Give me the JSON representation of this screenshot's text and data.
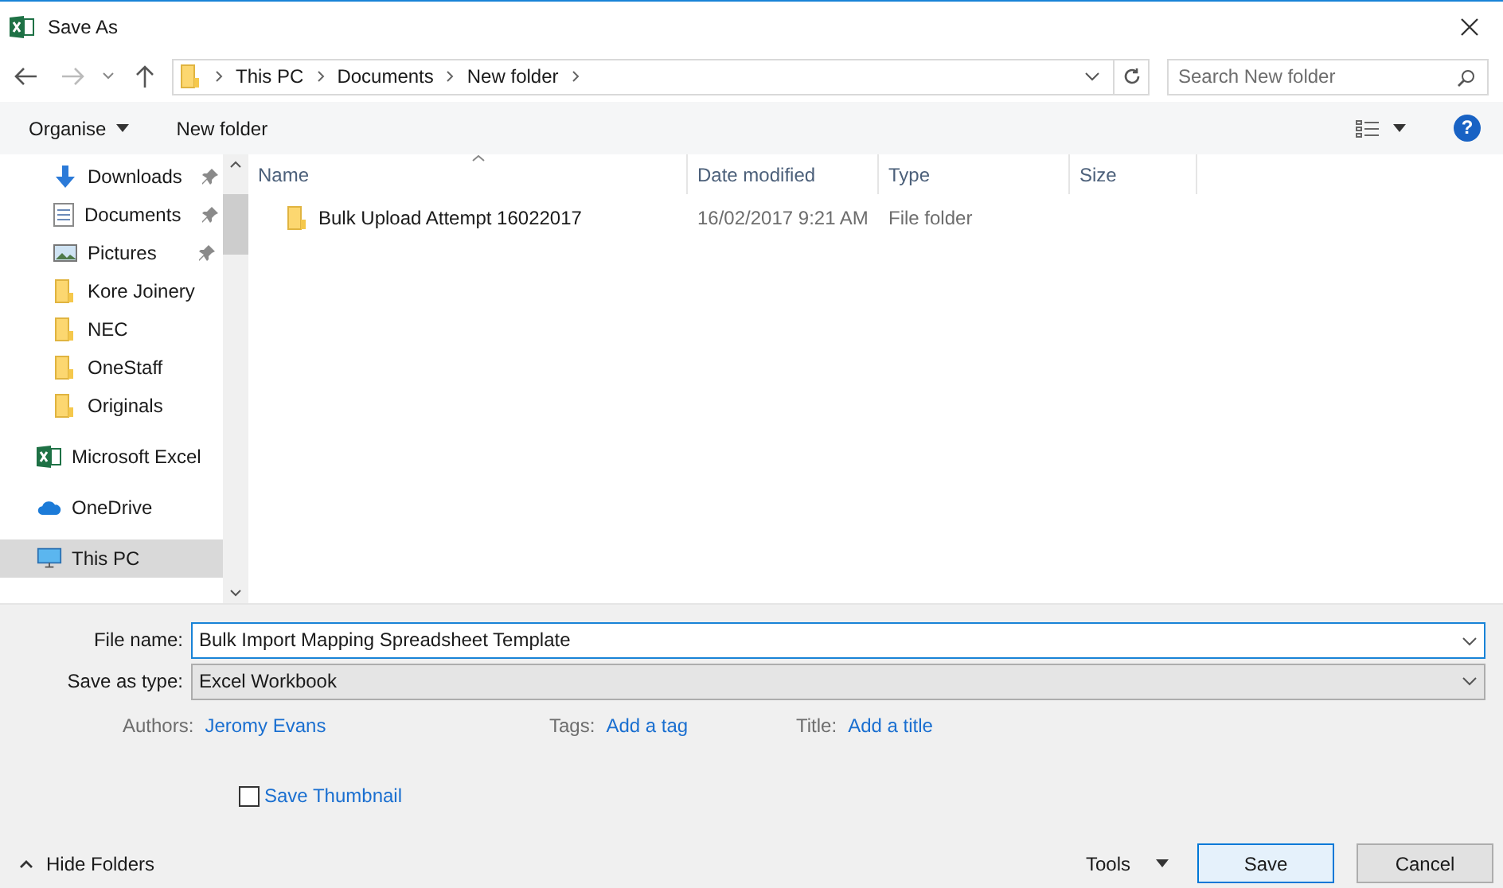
{
  "window": {
    "title": "Save As"
  },
  "breadcrumb": [
    "This PC",
    "Documents",
    "New folder"
  ],
  "search": {
    "placeholder": "Search New folder"
  },
  "toolbar": {
    "organise": "Organise",
    "new_folder": "New folder",
    "help": "?"
  },
  "sidebar": {
    "items": [
      {
        "label": "Downloads",
        "kind": "downloads",
        "pinned": true,
        "selected": false
      },
      {
        "label": "Documents",
        "kind": "documents",
        "pinned": true,
        "selected": false
      },
      {
        "label": "Pictures",
        "kind": "pictures",
        "pinned": true,
        "selected": false
      },
      {
        "label": "Kore Joinery",
        "kind": "folder",
        "pinned": false,
        "selected": false
      },
      {
        "label": "NEC",
        "kind": "folder",
        "pinned": false,
        "selected": false
      },
      {
        "label": "OneStaff",
        "kind": "folder",
        "pinned": false,
        "selected": false
      },
      {
        "label": "Originals",
        "kind": "folder",
        "pinned": false,
        "selected": false
      },
      {
        "label": "Microsoft Excel",
        "kind": "excel",
        "pinned": false,
        "selected": false
      },
      {
        "label": "OneDrive",
        "kind": "cloud",
        "pinned": false,
        "selected": false
      },
      {
        "label": "This PC",
        "kind": "pc",
        "pinned": false,
        "selected": true
      }
    ]
  },
  "table": {
    "columns": [
      "Name",
      "Date modified",
      "Type",
      "Size"
    ],
    "rows": [
      {
        "name": "Bulk Upload Attempt 16022017",
        "date": "16/02/2017 9:21 AM",
        "type": "File folder"
      }
    ]
  },
  "form": {
    "file_name_label": "File name:",
    "file_name": "Bulk Import Mapping Spreadsheet Template",
    "type_label": "Save as type:",
    "type": "Excel Workbook",
    "meta": [
      {
        "label": "Authors:",
        "value": "Jeromy Evans"
      },
      {
        "label": "Tags:",
        "value": "Add a tag"
      },
      {
        "label": "Title:",
        "value": "Add a title"
      }
    ],
    "thumbnail": {
      "label": "Save Thumbnail",
      "checked": false
    }
  },
  "footer": {
    "hide_folders": "Hide Folders",
    "tools": "Tools",
    "save": "Save",
    "cancel": "Cancel"
  }
}
